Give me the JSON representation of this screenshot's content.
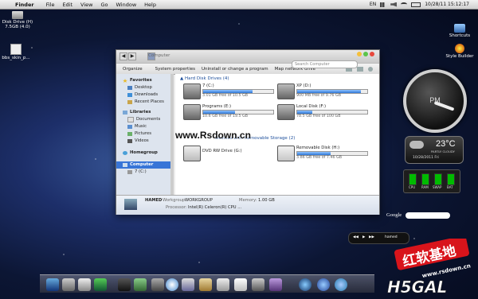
{
  "menubar": {
    "app_name": "Finder",
    "items": [
      "File",
      "Edit",
      "View",
      "Go",
      "Window",
      "Help"
    ],
    "input_source": "EN",
    "clock": "10/28/11 15:12:17"
  },
  "desktop_icons": [
    {
      "label": "Disk Drive (H)\n7.5GB (4.0)"
    },
    {
      "label": "bbs_skin_p..."
    },
    {
      "label": "Shortcuts"
    },
    {
      "label": "Style Builder"
    }
  ],
  "window": {
    "address": "Computer",
    "search_placeholder": "Search Computer",
    "toolbar": [
      "Organize",
      "System properties",
      "Uninstall or change a program",
      "Map network drive"
    ],
    "sidebar": [
      {
        "label": "Favorites",
        "group": true
      },
      {
        "label": "Desktop"
      },
      {
        "label": "Downloads"
      },
      {
        "label": "Recent Places"
      },
      {
        "label": "Libraries",
        "group": true
      },
      {
        "label": "Documents"
      },
      {
        "label": "Music"
      },
      {
        "label": "Pictures"
      },
      {
        "label": "Videos"
      },
      {
        "label": "Homegroup",
        "group": true
      },
      {
        "label": "Computer",
        "group": true,
        "selected": true
      },
      {
        "label": "7 (C:)"
      }
    ],
    "section_hdd": "Hard Disk Drives (4)",
    "section_removable": "Devices with Removable Storage (2)",
    "drives": [
      {
        "name": "7 (C:)",
        "free": "3.01 GB free of 10.5 GB",
        "used_fraction": 0.71
      },
      {
        "name": "XP (D:)",
        "free": "900 MB free of 9.76 GB",
        "used_fraction": 0.91
      },
      {
        "name": "Programs (E:)",
        "free": "10.6 GB free of 19.5 GB",
        "used_fraction": 0.46
      },
      {
        "name": "Local Disk (F:)",
        "free": "78.5 GB free of 100 GB",
        "used_fraction": 0.22
      }
    ],
    "removable": [
      {
        "name": "DVD RW Drive (G:)",
        "free": ""
      },
      {
        "name": "Removable Disk (H:)",
        "free": "3.86 GB free of 7.46 GB",
        "used_fraction": 0.48
      }
    ],
    "details": {
      "computer_name": "HAMED",
      "workgroup_label": "Workgroup:",
      "workgroup": "WORKGROUP",
      "memory_label": "Memory:",
      "memory": "1.00 GB",
      "processor_label": "Processor:",
      "processor": "Intel(R) Celeron(R) CPU ..."
    }
  },
  "watermark": "www.Rsdown.cn",
  "widgets": {
    "clock_text": "PM",
    "temperature": "23°C",
    "condition": "PARTLY CLOUDY",
    "weather_date": "10/28/2011 Fri",
    "sysmon": [
      "CPU",
      "RAM",
      "SWAP",
      "BAT"
    ],
    "search_label": "Google",
    "music_track": "hamed"
  },
  "brand": {
    "cn_text": "红软基地",
    "site": "www.rsdown.cn",
    "logo": "H5GAL"
  },
  "colors": {
    "selection": "#3875d7",
    "section_header": "#1c4e9b",
    "brand_red": "#d8141b"
  }
}
